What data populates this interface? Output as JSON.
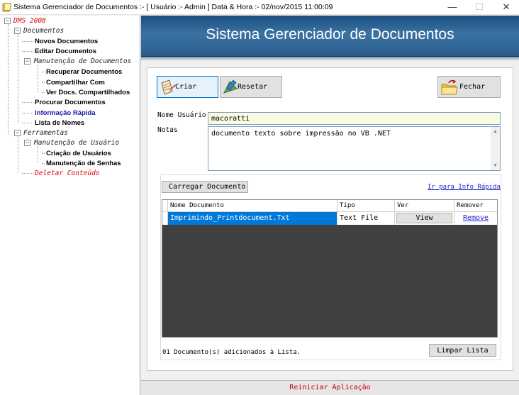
{
  "window": {
    "title": "Sistema Gerenciador de Documentos :- [ Usuário :- Admin ]  Data & Hora :- 02/nov/2015 11:00:09",
    "minimize": "—",
    "maximize": "☐",
    "close": "✕"
  },
  "tree": {
    "root": "DMS 2008",
    "documentos": "Documentos",
    "novos": "Novos Documentos",
    "editar": "Editar Documentos",
    "manutencao_docs": "Manutenção de Documentos",
    "recuperar": "Recuperar Documentos",
    "compartilhar": "Compartilhar Com",
    "ver_compartilhados": "Ver Docs. Compartilhados",
    "procurar": "Procurar Documentos",
    "info_rapida": "Informação Rápida",
    "lista_nomes": "Lista de Nomes",
    "ferramentas": "Ferramentas",
    "manutencao_usuario": "Manutenção de Usuário",
    "criacao_usuarios": "Criação de Usuários",
    "manutencao_senhas": "Manutenção de Senhas",
    "deletar": "Deletar Conteúdo"
  },
  "header": {
    "title": "Sistema Gerenciador de Documentos"
  },
  "toolbar": {
    "criar": "Criar",
    "resetar": "Resetar",
    "fechar": "Fechar"
  },
  "form": {
    "nome_label": "Nome Usuário",
    "nome_value": "macoratti",
    "notas_label": "Notas",
    "notas_value": "documento texto sobre impressão no VB .NET"
  },
  "documents": {
    "load_button": "Carregar Documento",
    "quick_link": "Ir para Info Rápida",
    "columns": [
      "Nome Documento",
      "Tipo",
      "Ver",
      "Remover"
    ],
    "rows": [
      {
        "nome": "Imprimindo_Printdocument.Txt",
        "tipo": "Text File",
        "ver": "View",
        "remover": "Remove"
      }
    ],
    "status": "01 Documento(s) adicionados à Lista.",
    "clear_button": "Limpar Lista"
  },
  "footer": {
    "restart": "Reiniciar Aplicação"
  },
  "colors": {
    "banner": "#2b5d8c",
    "selection": "#0078d7",
    "tree_red": "#e00000",
    "footer_red": "#c00000"
  }
}
